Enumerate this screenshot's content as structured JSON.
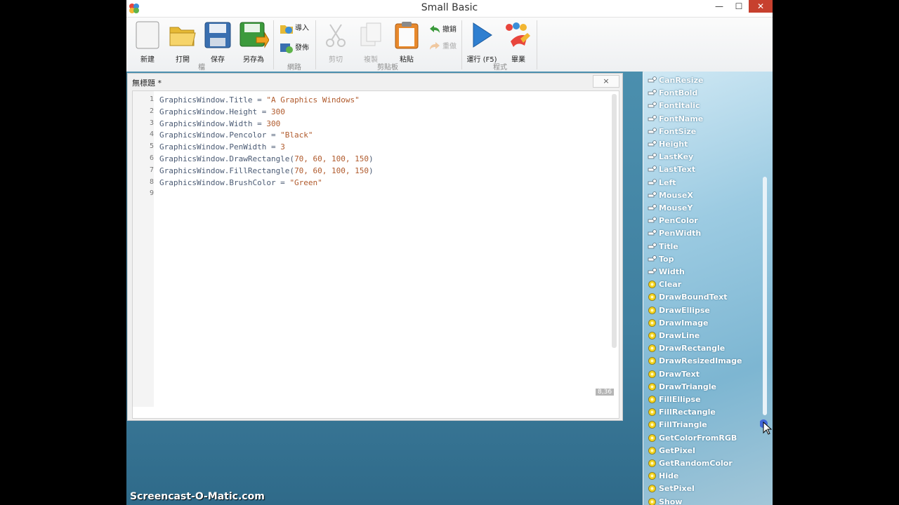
{
  "window": {
    "title": "Small Basic",
    "close_label": "✕",
    "minimize_label": "—",
    "maximize_label": "☐"
  },
  "ribbon": {
    "file_group": "檔",
    "web_group": "網路",
    "clipboard_group": "剪貼板",
    "program_group": "程式",
    "new": "新建",
    "open": "打開",
    "save": "保存",
    "save_as": "另存為",
    "import": "導入",
    "publish": "發佈",
    "cut": "剪切",
    "copy": "複製",
    "paste": "粘貼",
    "undo": "撤銷",
    "redo": "重做",
    "run": "運行 (F5)",
    "graduate": "畢業"
  },
  "editor": {
    "doc_title": "無標題 *",
    "close_label": "×",
    "cursor_position": "8,36",
    "lines": [
      {
        "num": "1",
        "code": "GraphicsWindow.Title = ",
        "str": "\"A Graphics Windows\""
      },
      {
        "num": "2",
        "code": "GraphicsWindow.Height = ",
        "str": "300"
      },
      {
        "num": "3",
        "code": "GraphicsWindow.Width = ",
        "str": "300"
      },
      {
        "num": "4",
        "code": "GraphicsWindow.Pencolor = ",
        "str": "\"Black\""
      },
      {
        "num": "5",
        "code": "GraphicsWindow.PenWidth = ",
        "str": "3"
      },
      {
        "num": "6",
        "code": "GraphicsWindow.DrawRectangle(",
        "str": "70, 60, 100, 150",
        "end": ")"
      },
      {
        "num": "7",
        "code": "GraphicsWindow.FillRectangle(",
        "str": "70, 60, 100, 150",
        "end": ")"
      },
      {
        "num": "8",
        "code": "GraphicsWindow.BrushColor = ",
        "str": "\"Green\""
      },
      {
        "num": "9",
        "code": "",
        "str": ""
      }
    ]
  },
  "members": {
    "properties": [
      "CanResize",
      "FontBold",
      "FontItalic",
      "FontName",
      "FontSize",
      "Height",
      "LastKey",
      "LastText",
      "Left",
      "MouseX",
      "MouseY",
      "PenColor",
      "PenWidth",
      "Title",
      "Top",
      "Width"
    ],
    "operations": [
      "Clear",
      "DrawBoundText",
      "DrawEllipse",
      "DrawImage",
      "DrawLine",
      "DrawRectangle",
      "DrawResizedImage",
      "DrawText",
      "DrawTriangle",
      "FillEllipse",
      "FillRectangle",
      "FillTriangle",
      "GetColorFromRGB",
      "GetPixel",
      "GetRandomColor",
      "Hide",
      "SetPixel",
      "Show"
    ]
  },
  "watermark": "Screencast-O-Matic.com",
  "colors": {
    "accent": "#4b8fae",
    "close": "#c7402e",
    "string": "#b05a2c",
    "code": "#4b5b74"
  }
}
